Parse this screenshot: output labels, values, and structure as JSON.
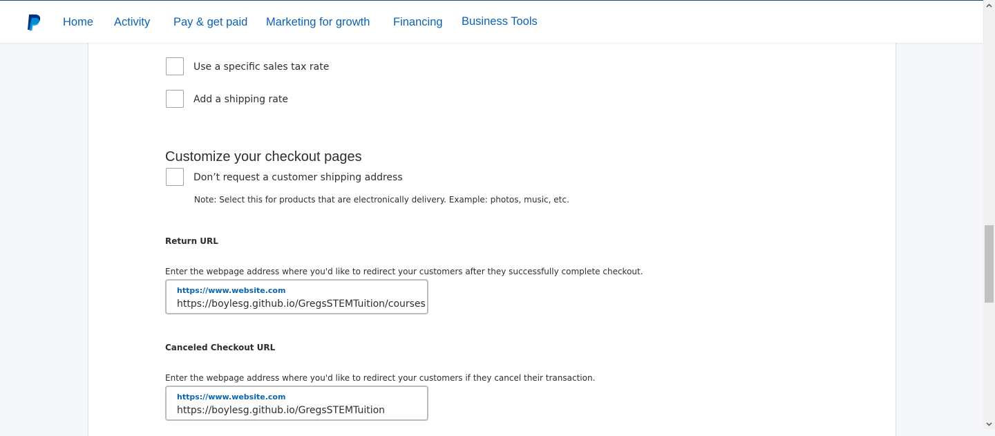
{
  "nav": {
    "logo": "paypal-logo",
    "items": [
      {
        "label": "Home"
      },
      {
        "label": "Activity"
      },
      {
        "label": "Pay & get paid"
      },
      {
        "label": "Marketing for growth"
      },
      {
        "label": "Financing"
      },
      {
        "label": "Business Tools"
      }
    ]
  },
  "options": {
    "sales_tax": {
      "label": "Use a specific sales tax rate",
      "checked": false
    },
    "shipping_rate": {
      "label": "Add a shipping rate",
      "checked": false
    }
  },
  "checkout": {
    "title": "Customize your checkout pages",
    "no_shipping": {
      "label": "Don’t request a customer shipping address",
      "checked": false
    },
    "note": "Note: Select this for products that are electronically delivery. Example: photos, music, etc."
  },
  "return_url": {
    "heading": "Return URL",
    "description": "Enter the webpage address where you'd like to redirect your customers after they successfully complete checkout.",
    "field_label": "https://www.website.com",
    "value": "https://boylesg.github.io/GregsSTEMTuition/courses"
  },
  "cancel_url": {
    "heading": "Canceled Checkout URL",
    "description": "Enter the webpage address where you'd like to redirect your customers if they cancel their transaction.",
    "field_label": "https://www.website.com",
    "value": "https://boylesg.github.io/GregsSTEMTuition"
  },
  "colors": {
    "link_blue": "#0b63b0",
    "logo_dark": "#003087",
    "logo_light": "#009cde",
    "text": "#2c2e2f"
  }
}
